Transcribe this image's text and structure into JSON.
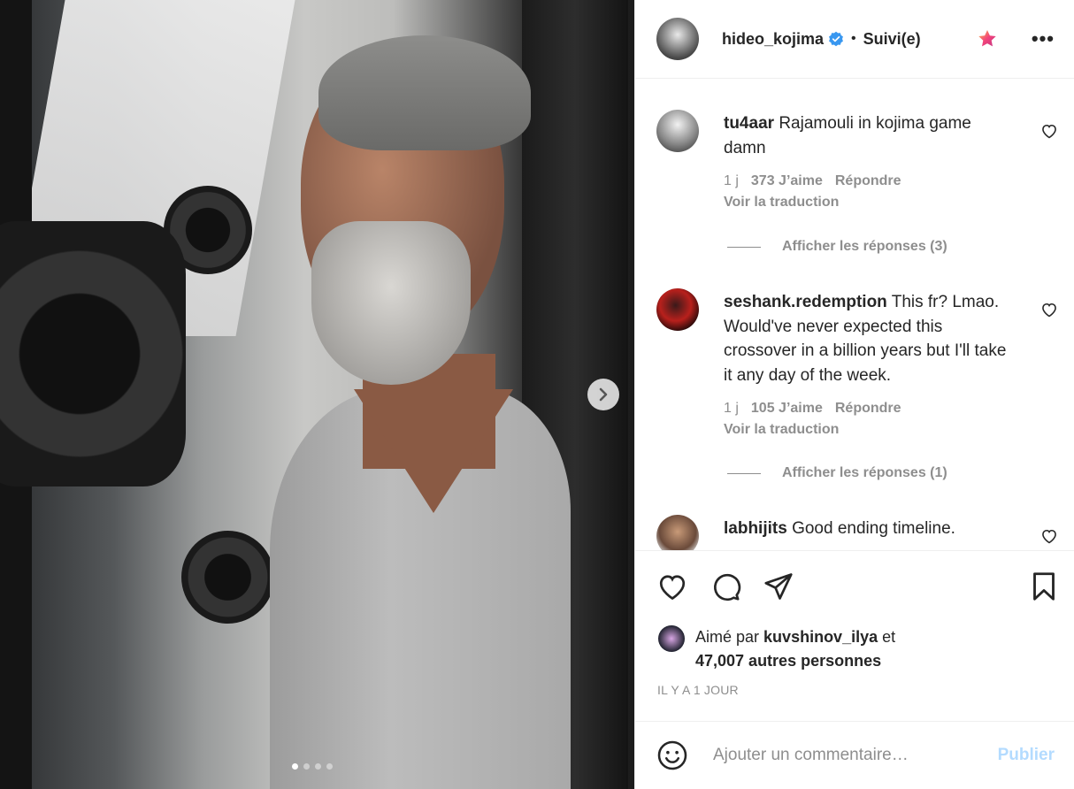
{
  "header": {
    "username": "hideo_kojima",
    "bullet": "•",
    "follow_label": "Suivi(e)",
    "more_label": "•••"
  },
  "comments": [
    {
      "user": "tu4aar",
      "text": "Rajamouli in kojima game damn",
      "age": "1 j",
      "likes": "373 J’aime",
      "reply": "Répondre",
      "translate": "Voir la traduction",
      "replies": "Afficher les réponses (3)"
    },
    {
      "user": "seshank.redemption",
      "text": "This fr? Lmao. Would've never expected this crossover in a billion years but I'll take it any day of the week.",
      "age": "1 j",
      "likes": "105 J’aime",
      "reply": "Répondre",
      "translate": "Voir la traduction",
      "replies": "Afficher les réponses (1)"
    },
    {
      "user": "labhijits",
      "text": "Good ending timeline."
    }
  ],
  "likes": {
    "prefix": "Aimé par",
    "user": "kuvshinov_ilya",
    "conjunction": "et",
    "others": "47,007 autres personnes"
  },
  "timestamp": "IL Y A 1 JOUR",
  "add_comment": {
    "placeholder": "Ajouter un commentaire…",
    "publish_label": "Publier"
  },
  "carousel": {
    "count": 4,
    "active_index": 0
  },
  "colors": {
    "verified": "#3897f0",
    "publish_disabled": "#b3dbff",
    "muted": "#8e8e8e",
    "text": "#262626"
  }
}
